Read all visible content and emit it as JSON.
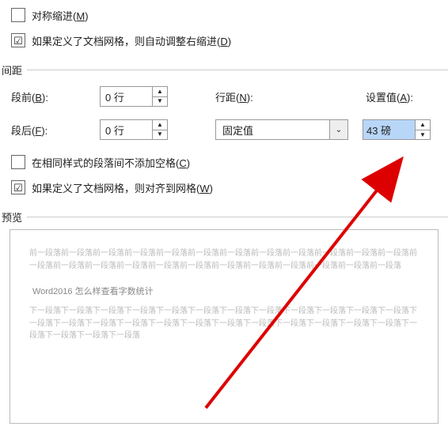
{
  "indent": {
    "symmetric": {
      "label": "对称缩进",
      "accel": "M",
      "checked": false
    },
    "grid_adjust": {
      "label": "如果定义了文档网格，则自动调整右缩进",
      "accel": "D",
      "checked": true
    }
  },
  "spacing_section": "间距",
  "spacing": {
    "before": {
      "label": "段前",
      "accel": "B",
      "value": "0 行"
    },
    "after": {
      "label": "段后",
      "accel": "F",
      "value": "0 行"
    },
    "line": {
      "label": "行距",
      "accel": "N",
      "value": "固定值"
    },
    "at": {
      "label": "设置值",
      "accel": "A",
      "value": "43 磅"
    },
    "no_space_same_style": {
      "label": "在相同样式的段落间不添加空格",
      "accel": "C",
      "checked": false
    },
    "snap_grid": {
      "label": "如果定义了文档网格，则对齐到网格",
      "accel": "W",
      "checked": true
    }
  },
  "preview_section": "预览",
  "preview": {
    "top_gray": "前一段落前一段落前一段落前一段落前一段落前一段落前一段落前一段落前一段落前一段落前一段落前一段落前一段落前一段落前一段落前一段落前一段落前一段落前一段落前一段落前一段落前一段落前一段落前一段落",
    "body": "Word2016 怎么样查看字数统计",
    "bottom_gray": "下一段落下一段落下一段落下一段落下一段落下一段落下一段落下一段落下一段落下一段落下一段落下一段落下一段落下一段落下一段落下一段落下一段落下一段落下一段落下一段落下一段落下一段落下一段落下一段落下一段落下一段落下一段落下一段落"
  }
}
